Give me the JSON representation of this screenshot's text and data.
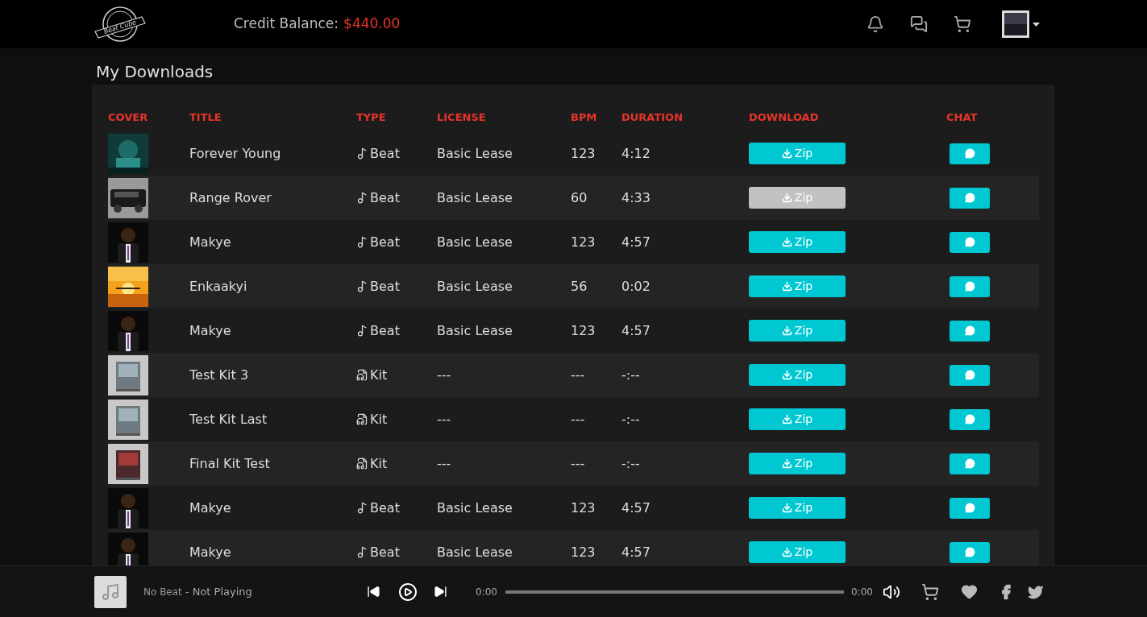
{
  "header": {
    "logo": {
      "text": "Beat Cube"
    },
    "credit_label": "Credit Balance:",
    "credit_value": "$440.00"
  },
  "page_title": "My Downloads",
  "table": {
    "columns": [
      "COVER",
      "TITLE",
      "TYPE",
      "LICENSE",
      "BPM",
      "DURATION",
      "DOWNLOAD",
      "CHAT"
    ],
    "rows": [
      {
        "title": "Forever Young",
        "kind": "beat",
        "type": "Beat",
        "license": "Basic Lease",
        "bpm": "123",
        "duration": "4:12",
        "download": "Zip",
        "disabled": false
      },
      {
        "title": "Range Rover",
        "kind": "beat",
        "type": "Beat",
        "license": "Basic Lease",
        "bpm": "60",
        "duration": "4:33",
        "download": "Zip",
        "disabled": true
      },
      {
        "title": "Makye",
        "kind": "beat",
        "type": "Beat",
        "license": "Basic Lease",
        "bpm": "123",
        "duration": "4:57",
        "download": "Zip",
        "disabled": false
      },
      {
        "title": "Enkaakyi",
        "kind": "beat",
        "type": "Beat",
        "license": "Basic Lease",
        "bpm": "56",
        "duration": "0:02",
        "download": "Zip",
        "disabled": false
      },
      {
        "title": "Makye",
        "kind": "beat",
        "type": "Beat",
        "license": "Basic Lease",
        "bpm": "123",
        "duration": "4:57",
        "download": "Zip",
        "disabled": false
      },
      {
        "title": "Test Kit 3",
        "kind": "kit",
        "type": "Kit",
        "license": "---",
        "bpm": "---",
        "duration": "-:--",
        "download": "Zip",
        "disabled": false
      },
      {
        "title": "Test Kit Last",
        "kind": "kit",
        "type": "Kit",
        "license": "---",
        "bpm": "---",
        "duration": "-:--",
        "download": "Zip",
        "disabled": false
      },
      {
        "title": "Final Kit Test",
        "kind": "kit",
        "type": "Kit",
        "license": "---",
        "bpm": "---",
        "duration": "-:--",
        "download": "Zip",
        "disabled": false
      },
      {
        "title": "Makye",
        "kind": "beat",
        "type": "Beat",
        "license": "Basic Lease",
        "bpm": "123",
        "duration": "4:57",
        "download": "Zip",
        "disabled": false
      },
      {
        "title": "Makye",
        "kind": "beat",
        "type": "Beat",
        "license": "Basic Lease",
        "bpm": "123",
        "duration": "4:57",
        "download": "Zip",
        "disabled": false
      }
    ]
  },
  "player": {
    "track": "No Beat",
    "separator": "-",
    "status": "Not Playing",
    "elapsed": "0:00",
    "total": "0:00",
    "level": 0
  }
}
